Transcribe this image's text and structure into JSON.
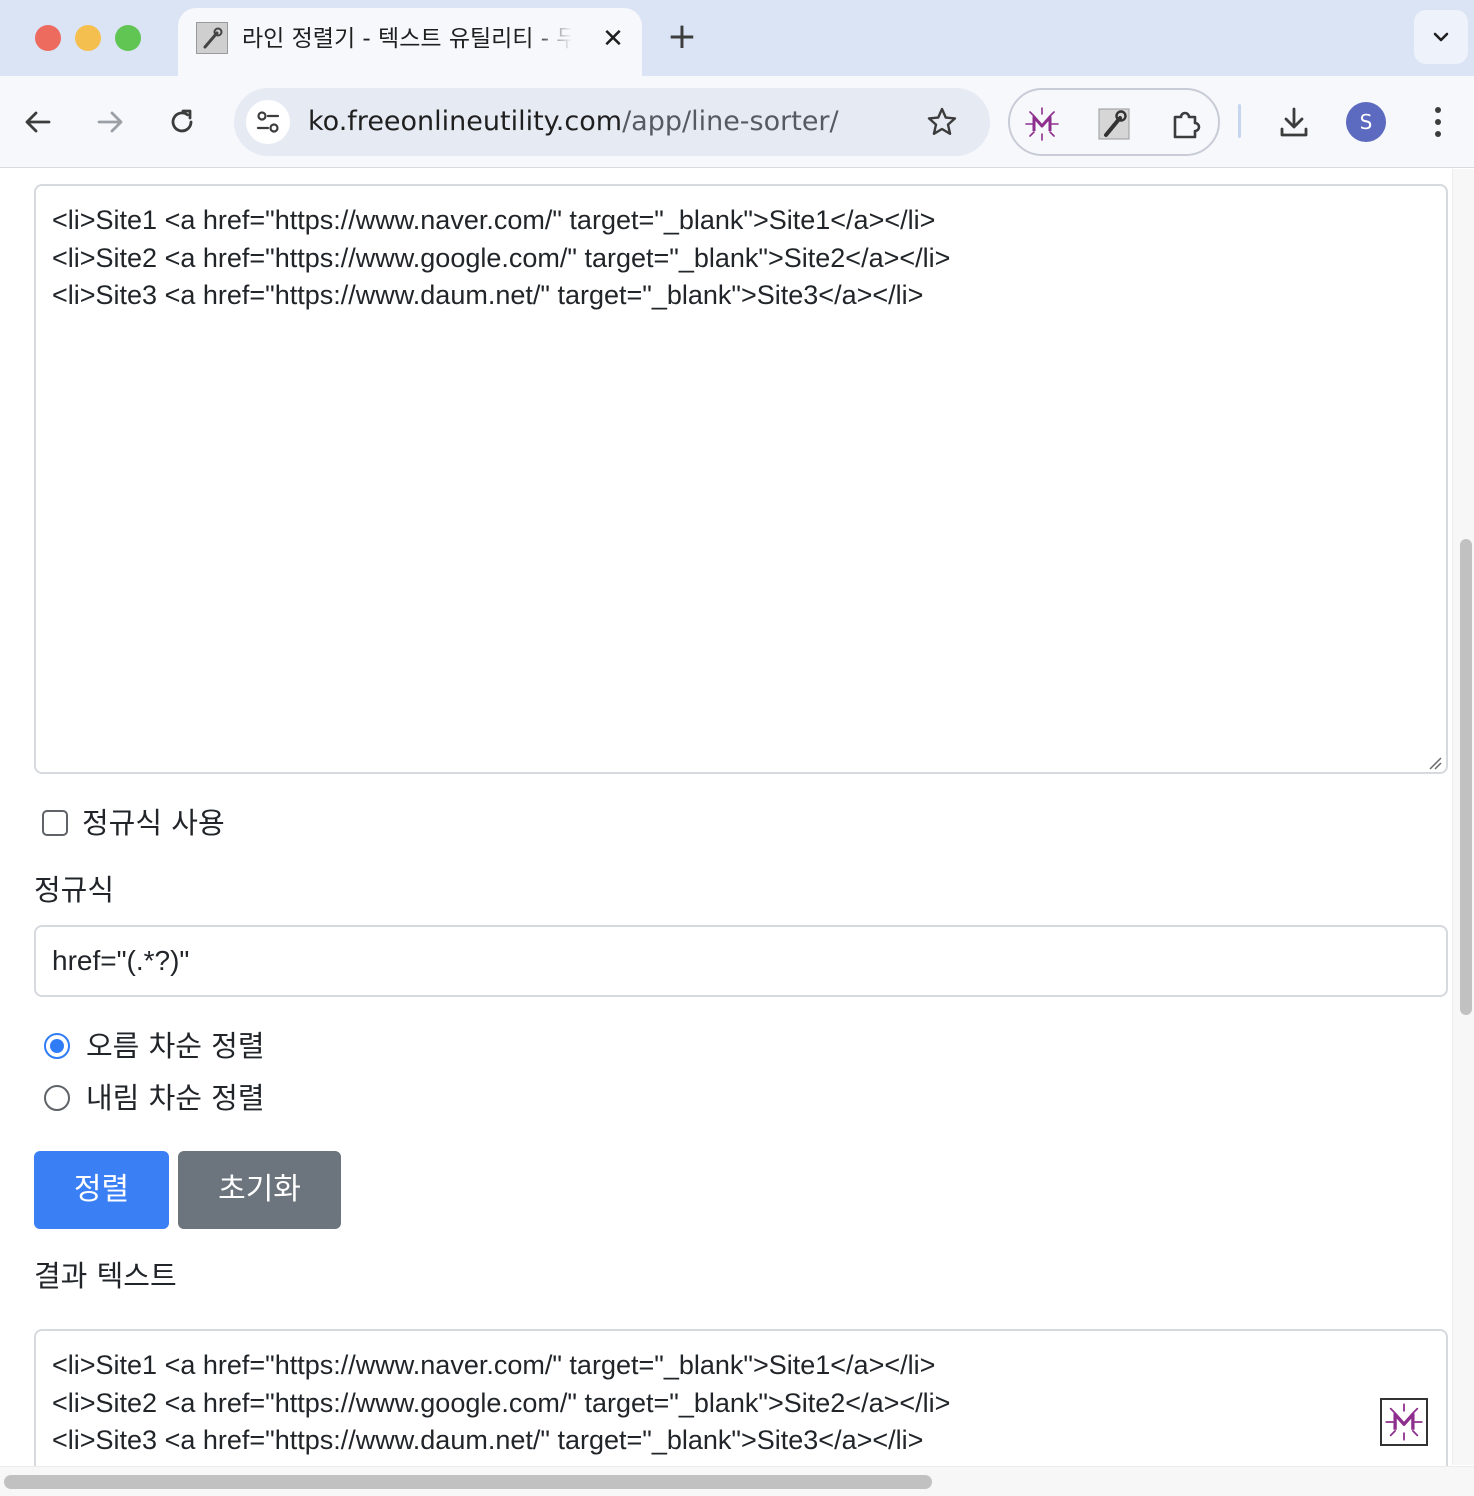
{
  "browser": {
    "tab": {
      "title": "라인 정렬기 - 텍스트 유틸리티 - 무료",
      "close_glyph": "✕"
    },
    "new_tab_glyph": "+",
    "url": {
      "host": "ko.freeonlineutility.com",
      "path": "/app/line-sorter/"
    },
    "profile_initial": "S",
    "icons": {
      "back": "arrow-left-icon",
      "forward": "arrow-right-icon",
      "reload": "reload-icon",
      "site_info": "tune-icon",
      "bookmark": "star-icon",
      "extension_1": "m-logo-icon",
      "extension_2": "wrench-icon",
      "extensions": "puzzle-icon",
      "download": "download-icon",
      "menu": "kebab-menu-icon",
      "tab_search": "chevron-down-icon"
    }
  },
  "page": {
    "input_text": "<li>Site1 <a href=\"https://www.naver.com/\" target=\"_blank\">Site1</a></li>\n<li>Site2 <a href=\"https://www.google.com/\" target=\"_blank\">Site2</a></li>\n<li>Site3 <a href=\"https://www.daum.net/\" target=\"_blank\">Site3</a></li>",
    "use_regex": {
      "label": "정규식 사용",
      "checked": false
    },
    "regex": {
      "label": "정규식",
      "value": "href=\"(.*?)\""
    },
    "order_options": [
      {
        "label": "오름 차순 정렬",
        "selected": true
      },
      {
        "label": "내림 차순 정렬",
        "selected": false
      }
    ],
    "buttons": {
      "sort": "정렬",
      "reset": "초기화"
    },
    "result": {
      "label": "결과 텍스트",
      "text": "<li>Site1 <a href=\"https://www.naver.com/\" target=\"_blank\">Site1</a></li>\n<li>Site2 <a href=\"https://www.google.com/\" target=\"_blank\">Site2</a></li>\n<li>Site3 <a href=\"https://www.daum.net/\" target=\"_blank\">Site3</a></li>"
    }
  },
  "colors": {
    "primary": "#3b7ff5",
    "secondary": "#6c757d",
    "tabstrip": "#dbe4f5",
    "radio_accent": "#2f7cf6"
  }
}
